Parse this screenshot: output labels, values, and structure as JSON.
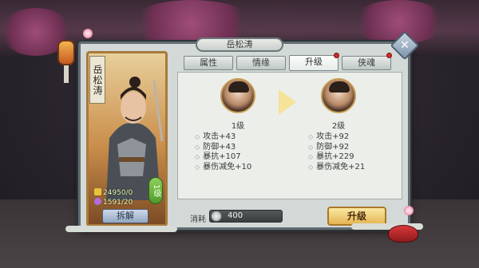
{
  "panel": {
    "title": "岳松涛"
  },
  "hero": {
    "name": "岳松涛",
    "level_badge": "1级",
    "stat_gold": "24950/0",
    "stat_shard": "1591/20",
    "dismantle_label": "拆解"
  },
  "tabs": [
    {
      "label": "属性",
      "active": false,
      "dot": false
    },
    {
      "label": "情缘",
      "active": false,
      "dot": false
    },
    {
      "label": "升级",
      "active": true,
      "dot": true
    },
    {
      "label": "侠魂",
      "active": false,
      "dot": true
    }
  ],
  "upgrade": {
    "current": {
      "level": "1级",
      "bonuses": [
        "攻击+43",
        "防御+43",
        "暴抗+107",
        "暴伤减免+10"
      ]
    },
    "next": {
      "level": "2级",
      "bonuses": [
        "攻击+92",
        "防御+92",
        "暴抗+229",
        "暴伤减免+21"
      ]
    },
    "cost_label": "消耗",
    "cost_value": "400",
    "button_label": "升级"
  },
  "icons": {
    "close": "close-icon",
    "arrow": "arrow-right-icon",
    "coin": "coin-icon"
  },
  "colors": {
    "tab_dot": "#d52a2a",
    "upgrade_button": "#e4b554",
    "level_badge": "#4d9a2b"
  }
}
